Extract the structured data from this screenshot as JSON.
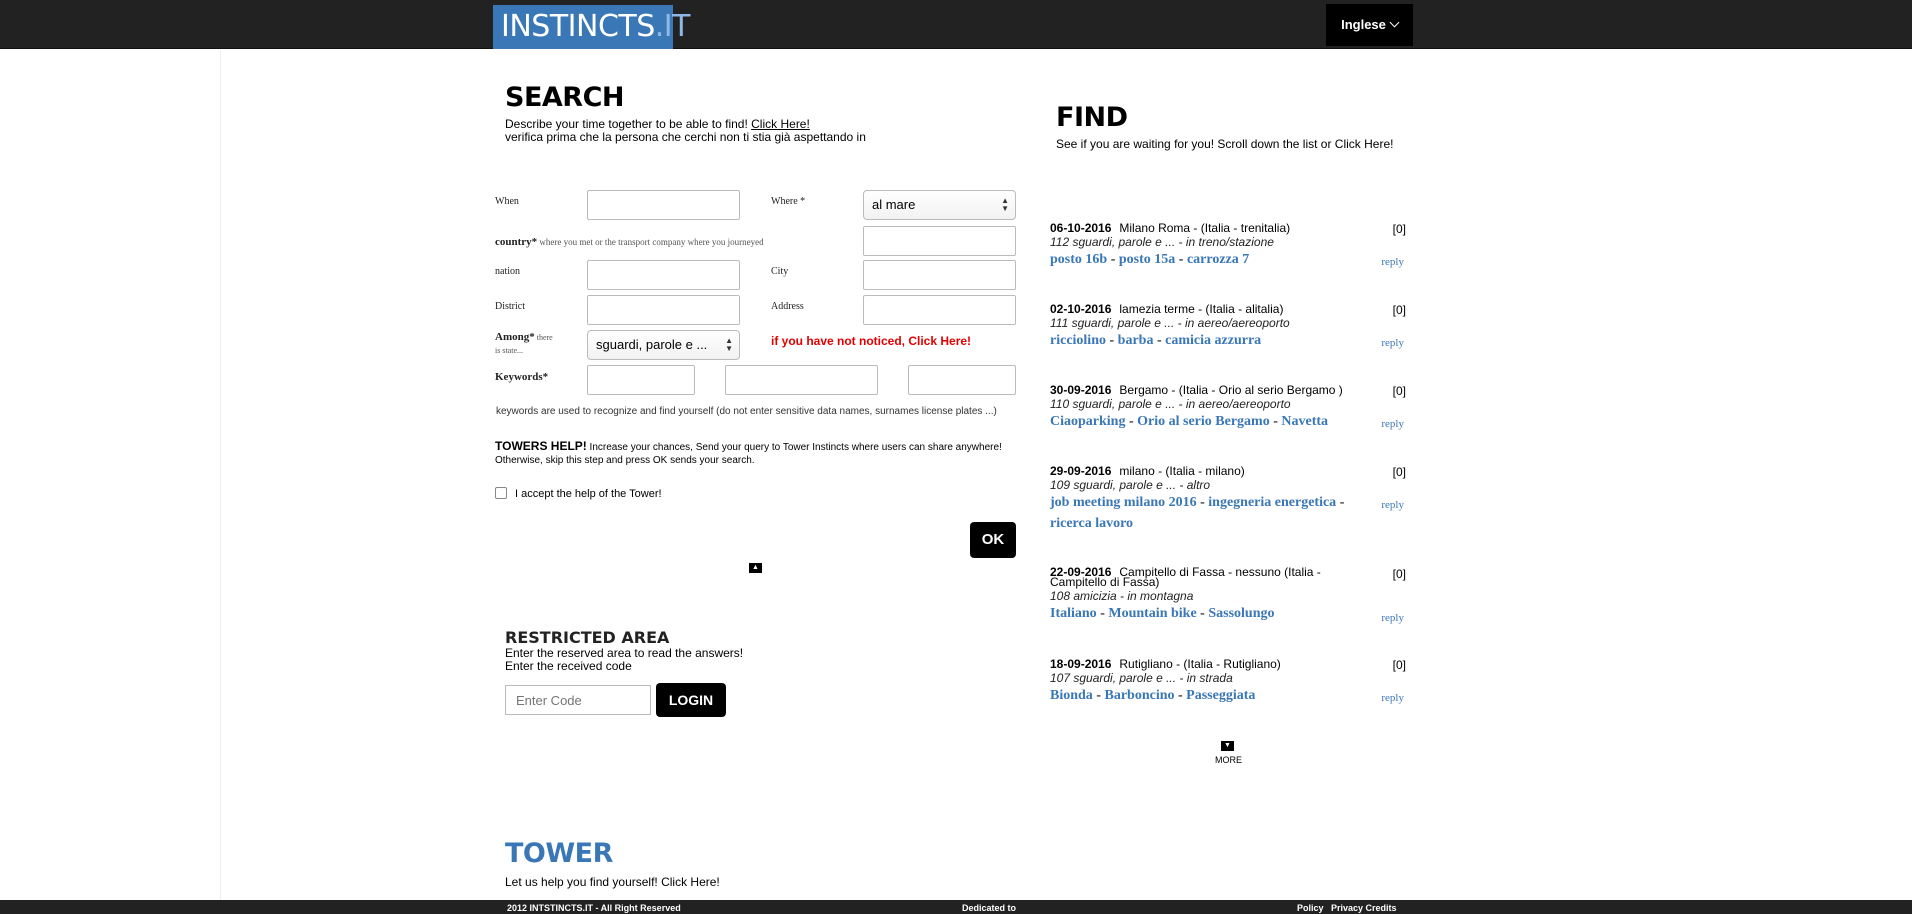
{
  "header": {
    "logo_main": "INSTINCTS",
    "logo_dot": ".IT",
    "language": "Inglese"
  },
  "search": {
    "title": "SEARCH",
    "desc_prefix": "Describe your time together to be able to find! ",
    "desc_link": "Click Here!",
    "desc_line2": "verifica prima che la persona che cerchi non ti stia già aspettando in",
    "labels": {
      "when": "When",
      "where": "Where *",
      "country": "country*",
      "country_hint": " where you met or the transport company where you journeyed",
      "nation": "nation",
      "city": "City",
      "district": "District",
      "address": "Address",
      "among": "Among*",
      "among_hint": " there is state...",
      "keywords": "Keywords*"
    },
    "where_value": "al mare",
    "among_value": "sguardi, parole e ...",
    "notice": "if you have not noticed, Click Here!",
    "keywords_note": "keywords are used to recognize and find yourself (do not enter sensitive data names, surnames license plates ...)",
    "tower_help_title": "TOWERS HELP!",
    "tower_help_text": " Increase your chances, Send your query to Tower Instincts where users can share anywhere!",
    "tower_help_text2": "Otherwise, skip this step and press OK sends your search.",
    "accept_label": "I accept the help of the Tower!",
    "ok_label": "OK"
  },
  "restricted": {
    "title": "RESTRICTED AREA",
    "line1": "Enter the reserved area to read the answers!",
    "line2": "Enter the received code",
    "code_placeholder": "Enter Code",
    "login_label": "LOGIN"
  },
  "tower": {
    "title": "TOWER",
    "subtitle": "Let us help you find yourself! Click Here!"
  },
  "find": {
    "title": "FIND",
    "subtitle": "See if you are waiting for you! Scroll down the list or Click Here!",
    "entries": [
      {
        "date": "06-10-2016",
        "place": "Milano Roma - (Italia - trenitalia)",
        "count": "[0]",
        "desc": "112 sguardi, parole e ... - in treno/stazione",
        "keywords": [
          "posto 16b",
          "posto 15a",
          "carrozza 7"
        ],
        "reply": "reply"
      },
      {
        "date": "02-10-2016",
        "place": "lamezia terme - (Italia - alitalia)",
        "count": "[0]",
        "desc": "111 sguardi, parole e ... - in aereo/aereoporto",
        "keywords": [
          "ricciolino",
          "barba",
          "camicia azzurra"
        ],
        "reply": "reply"
      },
      {
        "date": "30-09-2016",
        "place": "Bergamo - (Italia - Orio al serio Bergamo )",
        "count": "[0]",
        "desc": "110 sguardi, parole e ... - in aereo/aereoporto",
        "keywords": [
          "Ciaoparking",
          "Orio al serio Bergamo",
          "Navetta"
        ],
        "reply": "reply"
      },
      {
        "date": "29-09-2016",
        "place": "milano - (Italia - milano)",
        "count": "[0]",
        "desc": "109 sguardi, parole e ... - altro",
        "keywords": [
          "job meeting milano 2016",
          "ingegneria energetica",
          "ricerca lavoro"
        ],
        "reply": "reply"
      },
      {
        "date": "22-09-2016",
        "place": "Campitello di Fassa - nessuno (Italia - Campitello di Fassa)",
        "count": "[0]",
        "desc": "108 amicizia - in montagna",
        "keywords": [
          "Italiano",
          "Mountain bike",
          "Sassolungo"
        ],
        "reply": "reply"
      },
      {
        "date": "18-09-2016",
        "place": "Rutigliano - (Italia - Rutigliano)",
        "count": "[0]",
        "desc": "107 sguardi, parole e ... - in strada",
        "keywords": [
          "Bionda",
          "Barboncino",
          "Passeggiata"
        ],
        "reply": "reply"
      }
    ],
    "more_label": "MORE"
  },
  "footer": {
    "copyright": "2012 INTSTINCTS.IT - All Right Reserved",
    "dedicated": "Dedicated to",
    "policy": "Policy",
    "privacy": "Privacy Credits"
  }
}
